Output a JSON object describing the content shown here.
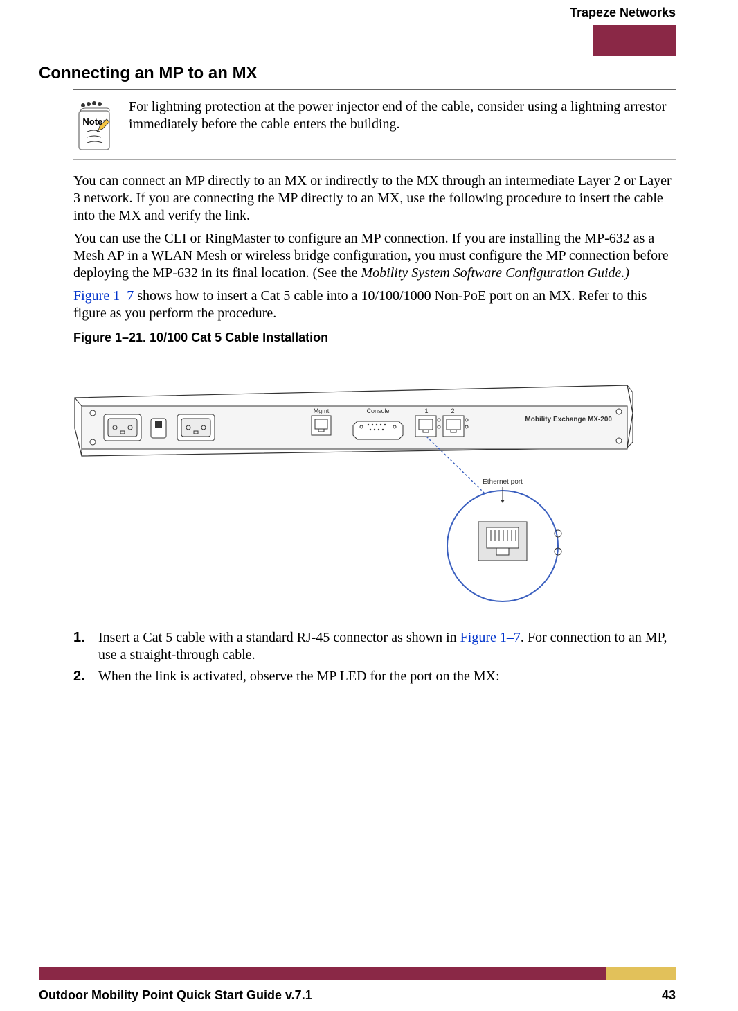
{
  "header": {
    "brand": "Trapeze Networks"
  },
  "section": {
    "heading": "Connecting an MP to an MX"
  },
  "note": {
    "label": "Note:",
    "text": "For lightning protection at the power injector end of the cable, consider using a lightning arrestor immediately before the cable enters the building."
  },
  "paragraphs": {
    "p1": "You can connect an MP directly to an MX or indirectly to the MX through an intermediate Layer 2 or Layer 3 network. If you are connecting the MP directly to an MX, use the following procedure to insert the cable into the MX and verify the link.",
    "p2_pre": "You can use the CLI or RingMaster to configure an MP connection. If you are installing the MP-632 as a Mesh AP in a WLAN Mesh or wireless bridge configuration, you must configure the MP connection before deploying the MP-632 in its final location. (See the ",
    "p2_italic": "Mobility System Software Configuration Guide.)",
    "p3_link": "Figure 1–7",
    "p3_rest": " shows how to insert a Cat 5 cable into a 10/100/1000 Non-PoE port on an MX. Refer to this figure as you perform the procedure."
  },
  "figure": {
    "caption": "Figure 1–21.  10/100 Cat 5 Cable Installation",
    "labels": {
      "mgmt": "Mgmt",
      "console": "Console",
      "port1": "1",
      "port2": "2",
      "brand_label": "Mobility Exchange  MX-200",
      "callout": "Ethernet port"
    }
  },
  "steps": [
    {
      "num": "1.",
      "text_pre": "Insert a Cat 5 cable with a standard RJ-45 connector as shown in ",
      "link": "Figure 1–7",
      "text_post": ". For connection to an MP, use a straight-through cable."
    },
    {
      "num": "2.",
      "text_pre": "When the link is activated, observe the MP LED for the port on the MX:",
      "link": "",
      "text_post": ""
    }
  ],
  "footer": {
    "title": "Outdoor Mobility Point Quick Start Guide v.7.1",
    "page": "43"
  }
}
